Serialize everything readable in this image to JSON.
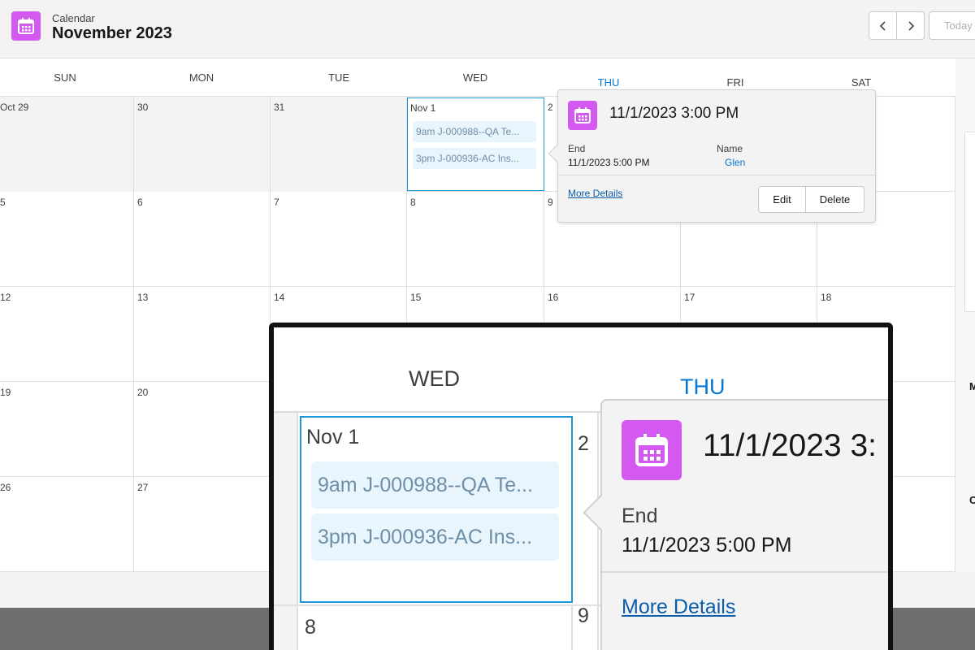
{
  "header": {
    "object_label": "Calendar",
    "title": "November 2023",
    "today_label": "Today",
    "prev_icon": "chevron-left-icon",
    "next_icon": "chevron-right-icon"
  },
  "weekdays": [
    "SUN",
    "MON",
    "TUE",
    "WED",
    "THU",
    "FRI",
    "SAT"
  ],
  "weeks": [
    [
      "Oct 29",
      "30",
      "31",
      "Nov 1",
      "2",
      "",
      ""
    ],
    [
      "5",
      "6",
      "7",
      "8",
      "9",
      "",
      ""
    ],
    [
      "12",
      "13",
      "14",
      "15",
      "16",
      "17",
      "18"
    ],
    [
      "19",
      "20",
      "",
      "",
      "",
      "",
      ""
    ],
    [
      "26",
      "27",
      "",
      "",
      "",
      "",
      ""
    ]
  ],
  "events": [
    {
      "label": "9am J-000988--QA Te..."
    },
    {
      "label": "3pm J-000936-AC Ins..."
    }
  ],
  "popover": {
    "title": "11/1/2023 3:00 PM",
    "end_label": "End",
    "end_value": "11/1/2023 5:00 PM",
    "name_label": "Name",
    "name_value": "Glen",
    "more_details": "More Details",
    "edit_label": "Edit",
    "delete_label": "Delete"
  },
  "zoom": {
    "dow_wed": "WED",
    "dow_thu": "THU",
    "day": "Nov 1",
    "next_day": "2",
    "below_day": "8",
    "below_next": "9",
    "title_partial": "11/1/2023 3:",
    "end_label": "End",
    "end_value": "11/1/2023 5:00 PM",
    "more_details": "More Details"
  },
  "side": {
    "mark_1": "M",
    "mark_2": "C"
  },
  "colors": {
    "accent": "#0176d3",
    "calendar_icon": "#d359f1",
    "event_bg": "#e8f5fd",
    "selected_border": "#1b96d6"
  }
}
